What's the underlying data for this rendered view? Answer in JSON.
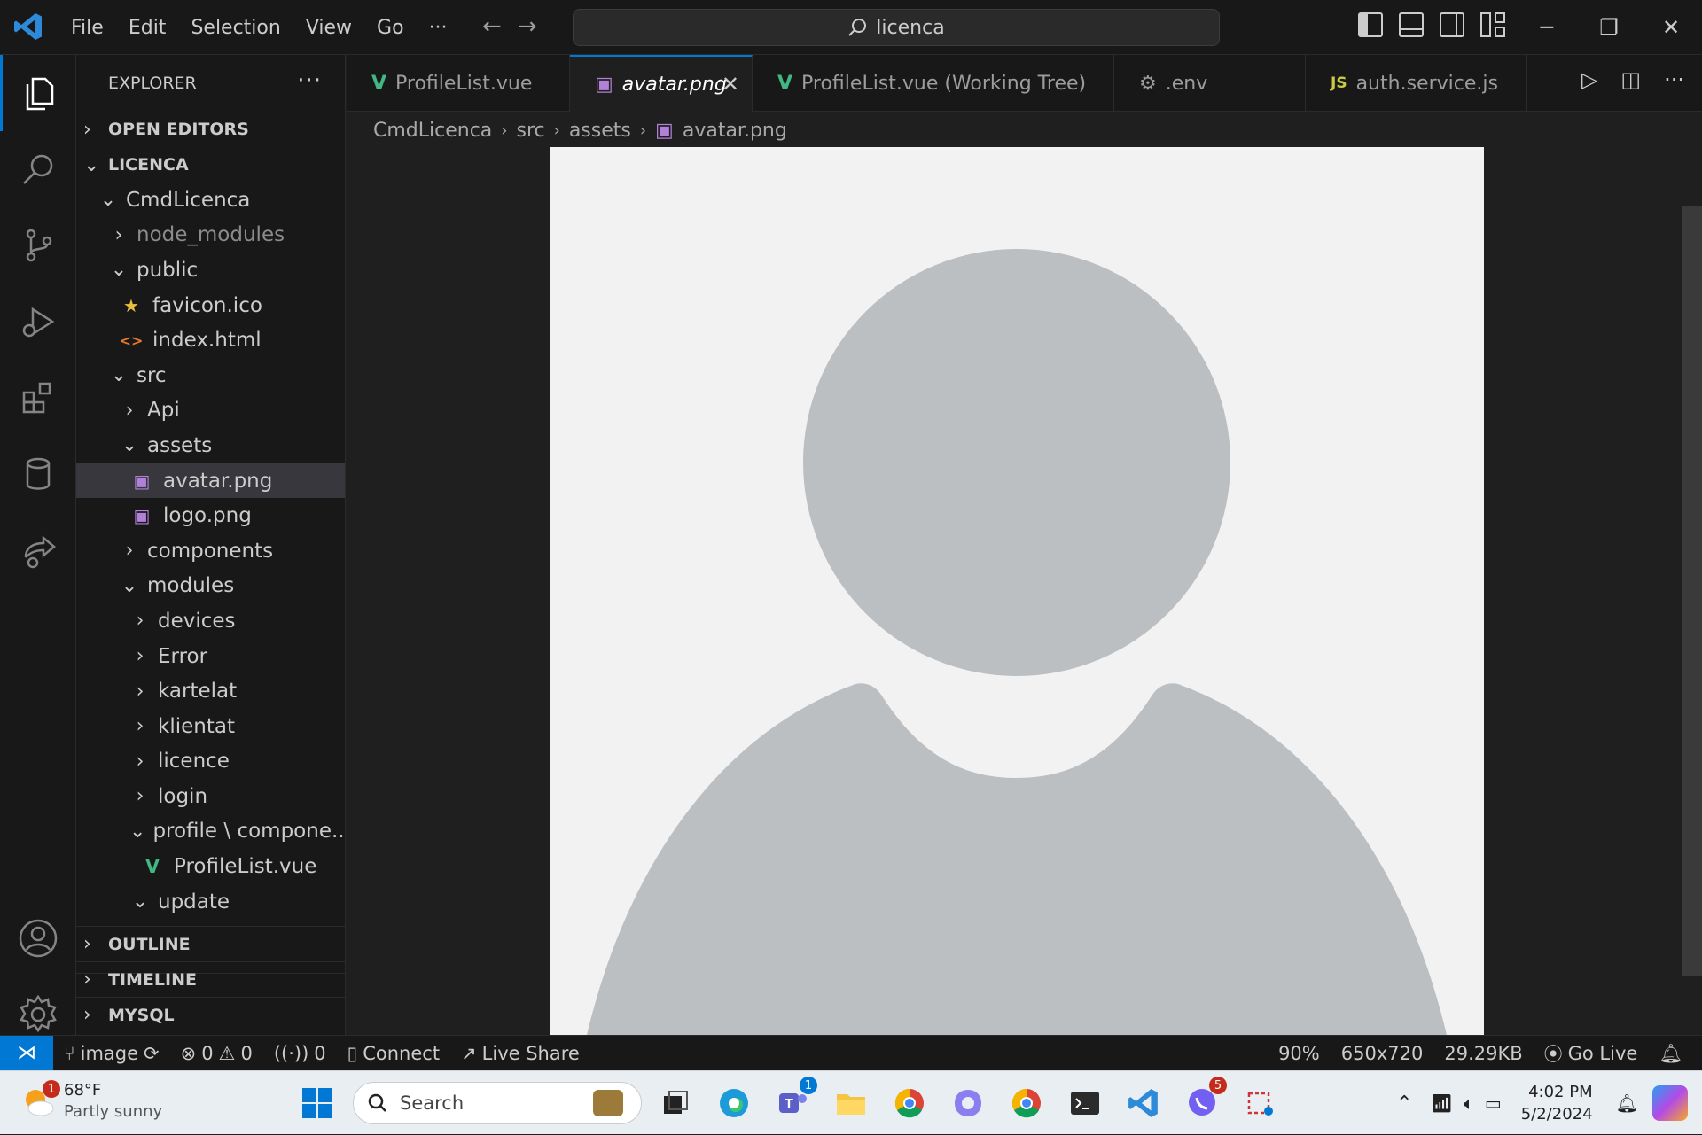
{
  "menu": [
    "File",
    "Edit",
    "Selection",
    "View",
    "Go"
  ],
  "menu_more": "···",
  "search": {
    "text": "licenca"
  },
  "explorer": {
    "title": "EXPLORER",
    "more": "···",
    "open_editors": "OPEN EDITORS",
    "workspace": "LICENCA",
    "tree": [
      {
        "label": "CmdLicenca",
        "indent": 1,
        "kind": "folder-open"
      },
      {
        "label": "node_modules",
        "indent": 2,
        "kind": "folder",
        "dim": true
      },
      {
        "label": "public",
        "indent": 2,
        "kind": "folder-open"
      },
      {
        "label": "favicon.ico",
        "indent": 3,
        "kind": "star"
      },
      {
        "label": "index.html",
        "indent": 3,
        "kind": "html"
      },
      {
        "label": "src",
        "indent": 2,
        "kind": "folder-open"
      },
      {
        "label": "Api",
        "indent": 3,
        "kind": "folder"
      },
      {
        "label": "assets",
        "indent": 3,
        "kind": "folder-open"
      },
      {
        "label": "avatar.png",
        "indent": 4,
        "kind": "image",
        "selected": true
      },
      {
        "label": "logo.png",
        "indent": 4,
        "kind": "image"
      },
      {
        "label": "components",
        "indent": 3,
        "kind": "folder"
      },
      {
        "label": "modules",
        "indent": 3,
        "kind": "folder-open"
      },
      {
        "label": "devices",
        "indent": 4,
        "kind": "folder"
      },
      {
        "label": "Error",
        "indent": 4,
        "kind": "folder"
      },
      {
        "label": "kartelat",
        "indent": 4,
        "kind": "folder"
      },
      {
        "label": "klientat",
        "indent": 4,
        "kind": "folder"
      },
      {
        "label": "licence",
        "indent": 4,
        "kind": "folder"
      },
      {
        "label": "login",
        "indent": 4,
        "kind": "folder"
      },
      {
        "label": "profile \\ compone...",
        "indent": 4,
        "kind": "folder-open"
      },
      {
        "label": "ProfileList.vue",
        "indent": 5,
        "kind": "vue"
      },
      {
        "label": "update",
        "indent": 4,
        "kind": "folder-open"
      }
    ],
    "sections": [
      "OUTLINE",
      "TIMELINE",
      "MYSQL"
    ]
  },
  "tabs": [
    {
      "label": "ProfileList.vue",
      "icon": "vue-icon",
      "active": false
    },
    {
      "label": "avatar.png",
      "icon": "image-icon",
      "active": true
    },
    {
      "label": "ProfileList.vue (Working Tree)",
      "icon": "vue-icon",
      "active": false
    },
    {
      "label": ".env",
      "icon": "gear-icon",
      "active": false
    },
    {
      "label": "auth.service.js",
      "icon": "js-icon",
      "active": false,
      "icon_text": "JS"
    }
  ],
  "breadcrumb": [
    "CmdLicenca",
    "src",
    "assets",
    "avatar.png"
  ],
  "status": {
    "branch": "image",
    "errors": "0",
    "warnings": "0",
    "ports": "0",
    "connect": "Connect",
    "live_share": "Live Share",
    "zoom": "90%",
    "dimensions": "650x720",
    "size": "29.29KB",
    "go_live": "Go Live"
  },
  "taskbar": {
    "weather_temp": "68°F",
    "weather_desc": "Partly sunny",
    "weather_badge": "1",
    "search": "Search",
    "teams_badge": "1",
    "viber_badge": "5",
    "time": "4:02 PM",
    "date": "5/2/2024"
  },
  "colors": {
    "accent": "#0078d4",
    "vue": "#41b883",
    "image": "#b180d7",
    "js": "#cbcb41",
    "html": "#e37933",
    "avatar_gray": "#bcbfc2",
    "canvas": "#f2f2f2"
  }
}
